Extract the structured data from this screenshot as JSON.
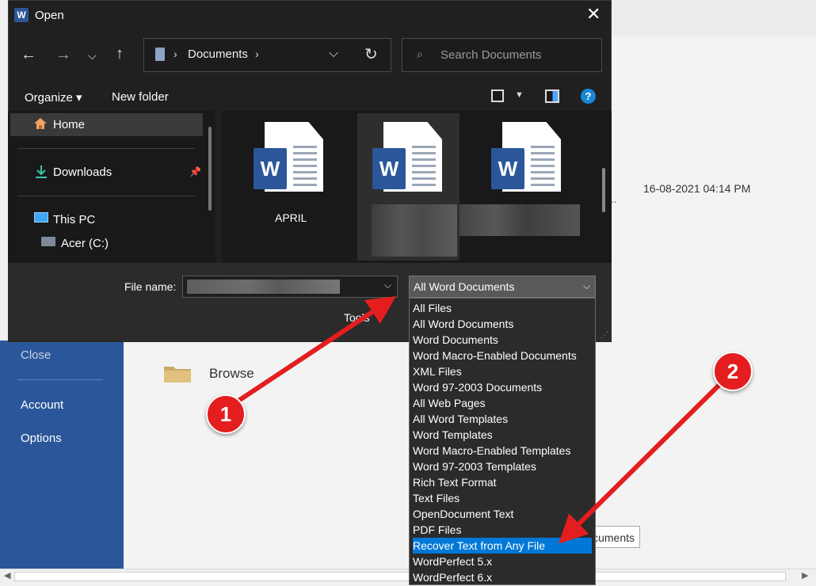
{
  "background": {
    "sidebar_items": [
      "Close",
      "Account",
      "Options"
    ],
    "recent_date": "16-08-2021 04:14 PM",
    "recent_truncated": "r...",
    "browse_label": "Browse",
    "documents_button": "cuments"
  },
  "dialog": {
    "title": "Open",
    "close_glyph": "✕",
    "address": {
      "location": "Documents"
    },
    "search": {
      "placeholder": "Search Documents"
    },
    "toolbar": {
      "organize": "Organize ▾",
      "new_folder": "New folder",
      "help": "?"
    },
    "nav": {
      "home": "Home",
      "downloads": "Downloads",
      "this_pc": "This PC",
      "drive": "Acer (C:)"
    },
    "files": [
      {
        "name": "APRIL"
      },
      {
        "name": ""
      },
      {
        "name": ""
      }
    ],
    "file_name_label": "File name:",
    "file_name_value": "",
    "file_type_selected": "All Word Documents",
    "tools_label": "Tools",
    "file_type_options": [
      "All Files",
      "All Word Documents",
      "Word Documents",
      "Word Macro-Enabled Documents",
      "XML Files",
      "Word 97-2003 Documents",
      "All Web Pages",
      "All Word Templates",
      "Word Templates",
      "Word Macro-Enabled Templates",
      "Word 97-2003 Templates",
      "Rich Text Format",
      "Text Files",
      "OpenDocument Text",
      "PDF Files",
      "Recover Text from Any File",
      "WordPerfect 5.x",
      "WordPerfect 6.x"
    ],
    "highlighted_option": "Recover Text from Any File"
  },
  "annotations": {
    "badge1": "1",
    "badge2": "2",
    "arrow_color": "#e41e1e"
  },
  "colors": {
    "word_blue": "#2b579a",
    "selection_blue": "#0078d7",
    "dialog_bg": "#202020"
  }
}
